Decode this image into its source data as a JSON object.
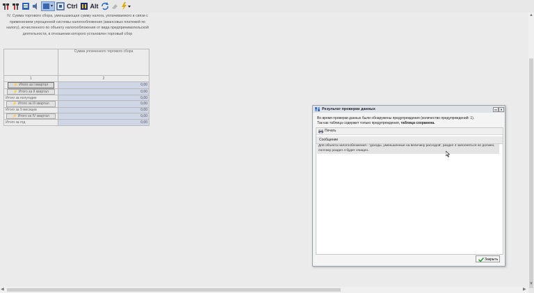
{
  "toolbar": {
    "items": [
      {
        "icon": "table-add-icon"
      },
      {
        "icon": "table-remove-icon"
      },
      {
        "icon": "form-icon"
      },
      {
        "icon": "sound-icon"
      },
      {
        "icon": "view-mode-icon"
      },
      {
        "icon": "fit-icon"
      },
      {
        "label": "Ctrl"
      },
      {
        "icon": "code-icon"
      },
      {
        "label": "Alt"
      },
      {
        "icon": "refresh-icon"
      },
      {
        "icon": "clear-icon"
      },
      {
        "icon": "lightning-icon"
      }
    ]
  },
  "section": {
    "title": "IV. Сумма торгового сбора, уменьшающая сумму налога, уплачиваемого в связи с применением упрощенной системы налогообложения (авансовых платежей по налогу), исчисленного по объекту налогообложения от вида предпринимательской деятельности, в отношении которого установлен торговый сбор"
  },
  "table": {
    "column_header": "Сумма уплаченного торгового сбора",
    "col_numbers": [
      "1",
      "2"
    ],
    "rows": [
      {
        "label": "Итого за I квартал",
        "value": "0,00",
        "button": true
      },
      {
        "label": "Итого за II квартал",
        "value": "0,00",
        "button": true
      },
      {
        "label": "Итого за полугодие",
        "value": "0,00",
        "button": false
      },
      {
        "label": "Итого за III квартал",
        "value": "0,00",
        "button": true
      },
      {
        "label": "Итого за 9 месяцев",
        "value": "0,00",
        "button": false
      },
      {
        "label": "Итого за IV квартал",
        "value": "0,00",
        "button": true
      },
      {
        "label": "Итого за год",
        "value": "0,00",
        "button": false
      }
    ]
  },
  "dialog": {
    "title": "Результат проверки данных",
    "message_line1": "Во время проверки данных были обнаружены предупреждения (количество предупреждений: 1).",
    "message_line2_prefix": "Так как таблица содержит только предупреждения, ",
    "message_line2_bold": "таблица сохранена.",
    "print_label": "Печать",
    "column_header": "Сообщение",
    "messages": [
      "Для объекта налогообложения - 'доходы, уменьшенные на величину расходов', раздел 4 заполняться не должен, поэтому раздел 4 будет очищен."
    ],
    "close_label": "Закрыть"
  }
}
